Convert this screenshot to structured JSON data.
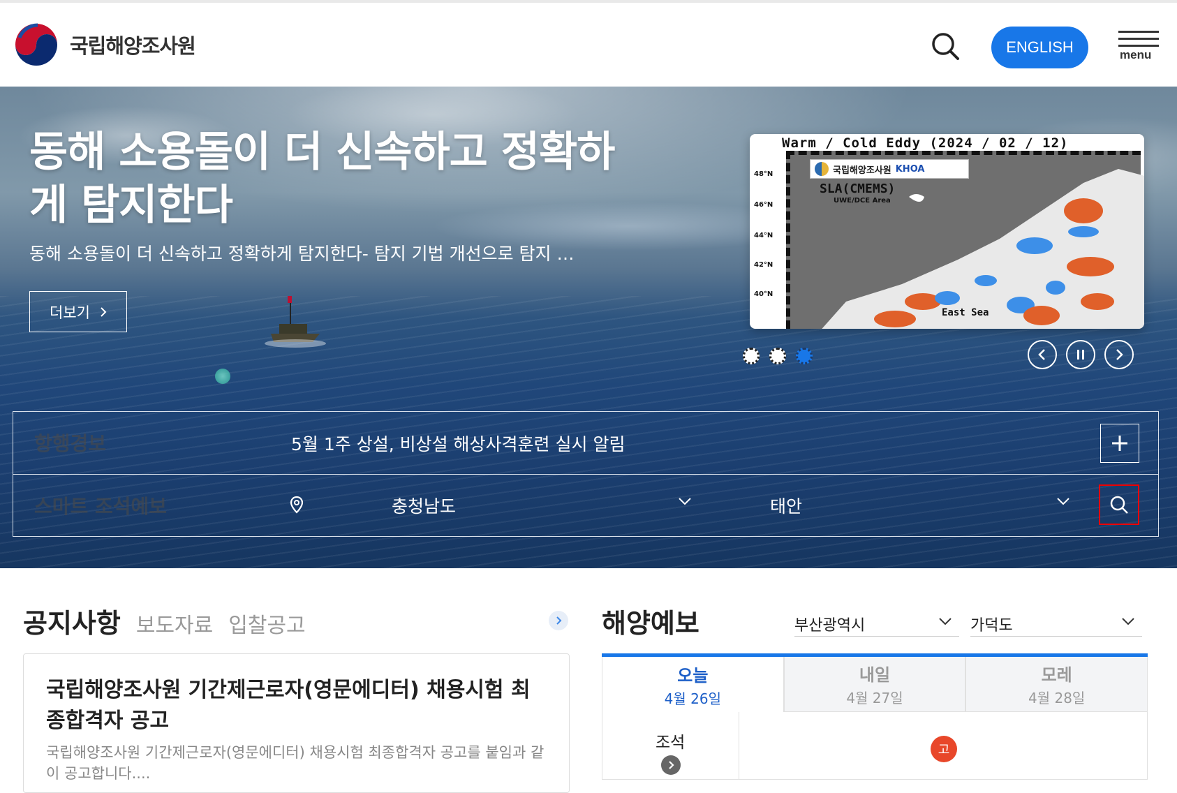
{
  "header": {
    "site_name": "국립해양조사원",
    "english_button": "ENGLISH",
    "menu_label": "menu"
  },
  "hero": {
    "title": "동해 소용돌이 더 신속하고 정확하게 탐지한다",
    "subtitle": "동해 소용돌이 더 신속하고 정확하게 탐지한다- 탐지 기법 개선으로 탐지 …",
    "more_button": "더보기",
    "map": {
      "title": "Warm / Cold Eddy (2024 / 02 / 12)",
      "badge_org": "국립해양조사원",
      "badge_khoa": "KHOA",
      "sla": "SLA(CMEMS)",
      "uwe": "UWE/DCE Area",
      "lat_labels": [
        "48°N",
        "46°N",
        "44°N",
        "42°N",
        "40°N"
      ],
      "sea_label": "East Sea"
    },
    "slide_count": 3,
    "active_slide": 3
  },
  "info": {
    "warning_label": "항행경보",
    "warning_notice": "5월 1주 상설, 비상설 해상사격훈련 실시 알림",
    "tide_label": "스마트 조석예보",
    "region_select": "충청남도",
    "area_select": "태안"
  },
  "notice": {
    "tabs": [
      "공지사항",
      "보도자료",
      "입찰공고"
    ],
    "title": "국립해양조사원 기간제근로자(영문에디터) 채용시험 최종합격자 공고",
    "body": "국립해양조사원 기간제근로자(영문에디터) 채용시험 최종합격자 공고를 붙임과 같이 공고합니다...."
  },
  "forecast": {
    "title": "해양예보",
    "city_select": "부산광역시",
    "spot_select": "가덕도",
    "days": [
      {
        "name": "오늘",
        "date": "4월 26일"
      },
      {
        "name": "내일",
        "date": "4월 27일"
      },
      {
        "name": "모레",
        "date": "4월 28일"
      }
    ],
    "row_label": "조석",
    "badge": "고"
  },
  "colors": {
    "accent": "#1877e8",
    "alert": "#e8472a",
    "search_outline": "#ee0000"
  }
}
